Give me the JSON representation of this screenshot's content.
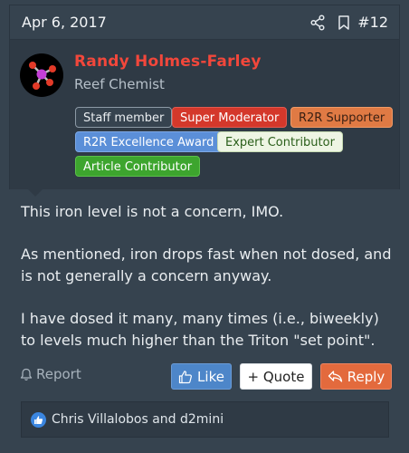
{
  "post": {
    "date": "Apr 6, 2017",
    "number": "#12",
    "header_icons": [
      "share-icon",
      "bookmark-icon"
    ]
  },
  "user": {
    "name": "Randy Holmes-Farley",
    "title": "Reef Chemist",
    "name_color": "#f2473b",
    "badges": {
      "staff": "Staff member",
      "super_mod": "Super Moderator",
      "r2r_supporter": "R2R Supporter",
      "excellence": "R2R Excellence Award",
      "expert": "Expert Contributor",
      "article": "Article Contributor"
    }
  },
  "body": {
    "p1": "This iron level is not a concern, IMO.",
    "p2": "As mentioned, iron drops fast when not dosed, and is not generally a concern anyway.",
    "p3": "I have dosed it many, many times (i.e., biweekly) to levels much higher than the Triton \"set point\"."
  },
  "actions": {
    "report": "Report",
    "like": "Like",
    "quote": "+ Quote",
    "reply": "Reply"
  },
  "reactions": {
    "icon": "thumbs-up-icon",
    "text": "Chris Villalobos and d2mini"
  },
  "colors": {
    "background": "#36434f",
    "panel": "#2f3a45",
    "like": "#4d86c9",
    "reply": "#e36a3d"
  }
}
